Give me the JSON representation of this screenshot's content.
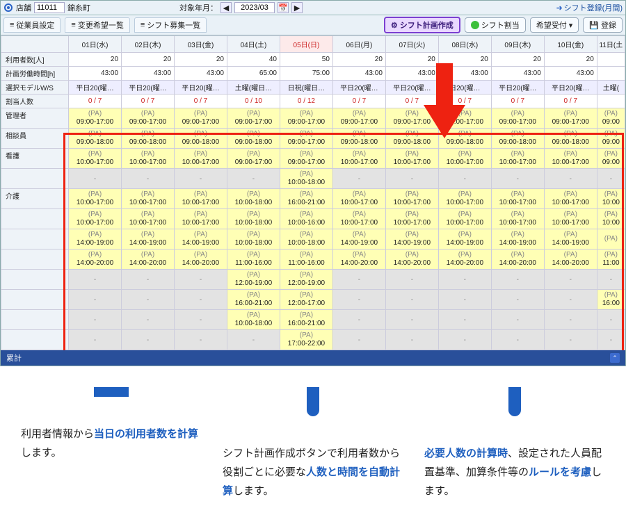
{
  "topbar": {
    "store_label": "店舗",
    "store_code": "11011",
    "store_name": "錦糸町",
    "period_label": "対象年月：",
    "period_value": "2023/03",
    "register_month": "シフト登録(月間)"
  },
  "tabs": {
    "emp_settings": "従業員設定",
    "change_req_list": "変更希望一覧",
    "recruit_list": "シフト募集一覧",
    "plan_create": "シフト計画作成",
    "shift_assign": "シフト割当",
    "pref_accept": "希望受付",
    "register": "登録"
  },
  "row_labels": {
    "users": "利用者数[人]",
    "plan_hours": "計画労働時間[h]",
    "model": "選択モデルW/S",
    "assigned": "割当人数",
    "manager": "管理者",
    "counselor": "相談員",
    "nurse": "看護",
    "care": "介護"
  },
  "pa_label": "(PA)",
  "dash": "-",
  "footer_label": "累計",
  "dates": [
    {
      "label": "01日(水)",
      "sunday": false
    },
    {
      "label": "02日(木)",
      "sunday": false
    },
    {
      "label": "03日(金)",
      "sunday": false
    },
    {
      "label": "04日(土)",
      "sunday": false
    },
    {
      "label": "05日(日)",
      "sunday": true
    },
    {
      "label": "06日(月)",
      "sunday": false
    },
    {
      "label": "07日(火)",
      "sunday": false
    },
    {
      "label": "08日(水)",
      "sunday": false
    },
    {
      "label": "09日(木)",
      "sunday": false
    },
    {
      "label": "10日(金)",
      "sunday": false
    },
    {
      "label": "11日(土",
      "sunday": false
    }
  ],
  "users_row": [
    "20",
    "20",
    "20",
    "40",
    "50",
    "20",
    "20",
    "20",
    "20",
    "20",
    ""
  ],
  "hours_row": [
    "43:00",
    "43:00",
    "43:00",
    "65:00",
    "75:00",
    "43:00",
    "43:00",
    "43:00",
    "43:00",
    "43:00",
    ""
  ],
  "model_row": [
    "平日20(曜…",
    "平日20(曜…",
    "平日20(曜…",
    "土曜(曜日…",
    "日祝(曜日…",
    "平日20(曜…",
    "平日20(曜…",
    "日20(曜…",
    "平日20(曜…",
    "平日20(曜…",
    "土曜("
  ],
  "assigned_row": [
    "0 / 7",
    "0 / 7",
    "0 / 7",
    "0 / 10",
    "0 / 12",
    "0 / 7",
    "0 / 7",
    "0 / 7",
    "0 / 7",
    "0 / 7",
    ""
  ],
  "shift_rows": [
    {
      "role": "manager",
      "cells": [
        {
          "t": "09:00-17:00"
        },
        {
          "t": "09:00-17:00"
        },
        {
          "t": "09:00-17:00"
        },
        {
          "t": "09:00-17:00"
        },
        {
          "t": "09:00-17:00"
        },
        {
          "t": "09:00-17:00"
        },
        {
          "t": "09:00-17:00"
        },
        {
          "t": "09:00-17:00"
        },
        {
          "t": "09:00-17:00"
        },
        {
          "t": "09:00-17:00"
        },
        {
          "t": "09:00",
          "cut": true
        }
      ]
    },
    {
      "role": "counselor",
      "cells": [
        {
          "t": "09:00-18:00"
        },
        {
          "t": "09:00-18:00"
        },
        {
          "t": "09:00-18:00"
        },
        {
          "t": "09:00-18:00"
        },
        {
          "t": "09:00-17:00"
        },
        {
          "t": "09:00-18:00"
        },
        {
          "t": "09:00-18:00"
        },
        {
          "t": "09:00-18:00"
        },
        {
          "t": "09:00-18:00"
        },
        {
          "t": "09:00-18:00"
        },
        {
          "t": "09:00",
          "cut": true
        }
      ]
    },
    {
      "role": "nurse",
      "cells": [
        {
          "t": "10:00-17:00"
        },
        {
          "t": "10:00-17:00"
        },
        {
          "t": "10:00-17:00"
        },
        {
          "t": "09:00-17:00"
        },
        {
          "t": "09:00-17:00"
        },
        {
          "t": "10:00-17:00"
        },
        {
          "t": "10:00-17:00"
        },
        {
          "t": "10:00-17:00"
        },
        {
          "t": "10:00-17:00"
        },
        {
          "t": "10:00-17:00"
        },
        {
          "t": "09:00",
          "cut": true
        }
      ]
    },
    {
      "role": "",
      "cells": [
        {
          "blank": true
        },
        {
          "blank": true
        },
        {
          "blank": true
        },
        {
          "blank": true
        },
        {
          "t": "10:00-18:00"
        },
        {
          "blank": true
        },
        {
          "blank": true
        },
        {
          "blank": true
        },
        {
          "blank": true
        },
        {
          "blank": true
        },
        {
          "blank": true
        }
      ]
    },
    {
      "role": "care",
      "cells": [
        {
          "t": "10:00-17:00"
        },
        {
          "t": "10:00-17:00"
        },
        {
          "t": "10:00-17:00"
        },
        {
          "t": "10:00-18:00"
        },
        {
          "t": "16:00-21:00"
        },
        {
          "t": "10:00-17:00"
        },
        {
          "t": "10:00-17:00"
        },
        {
          "t": "10:00-17:00"
        },
        {
          "t": "10:00-17:00"
        },
        {
          "t": "10:00-17:00"
        },
        {
          "t": "10:00",
          "cut": true
        }
      ]
    },
    {
      "role": "",
      "cells": [
        {
          "t": "10:00-17:00"
        },
        {
          "t": "10:00-17:00"
        },
        {
          "t": "10:00-17:00"
        },
        {
          "t": "10:00-18:00"
        },
        {
          "t": "10:00-16:00"
        },
        {
          "t": "10:00-17:00"
        },
        {
          "t": "10:00-17:00"
        },
        {
          "t": "10:00-17:00"
        },
        {
          "t": "10:00-17:00"
        },
        {
          "t": "10:00-17:00"
        },
        {
          "t": "10:00",
          "cut": true
        }
      ]
    },
    {
      "role": "",
      "cells": [
        {
          "t": "14:00-19:00"
        },
        {
          "t": "14:00-19:00"
        },
        {
          "t": "14:00-19:00"
        },
        {
          "t": "10:00-18:00"
        },
        {
          "t": "10:00-18:00"
        },
        {
          "t": "14:00-19:00"
        },
        {
          "t": "14:00-19:00"
        },
        {
          "t": "14:00-19:00"
        },
        {
          "t": "14:00-19:00"
        },
        {
          "t": "14:00-19:00"
        },
        {
          "t": "",
          "cut": true
        }
      ]
    },
    {
      "role": "",
      "cells": [
        {
          "t": "14:00-20:00"
        },
        {
          "t": "14:00-20:00"
        },
        {
          "t": "14:00-20:00"
        },
        {
          "t": "11:00-16:00"
        },
        {
          "t": "11:00-16:00"
        },
        {
          "t": "14:00-20:00"
        },
        {
          "t": "14:00-20:00"
        },
        {
          "t": "14:00-20:00"
        },
        {
          "t": "14:00-20:00"
        },
        {
          "t": "14:00-20:00"
        },
        {
          "t": "11:00",
          "cut": true
        }
      ]
    },
    {
      "role": "",
      "cells": [
        {
          "blank": true
        },
        {
          "blank": true
        },
        {
          "blank": true
        },
        {
          "t": "12:00-19:00"
        },
        {
          "t": "12:00-19:00"
        },
        {
          "blank": true
        },
        {
          "blank": true
        },
        {
          "blank": true
        },
        {
          "blank": true
        },
        {
          "blank": true
        },
        {
          "blank": true
        }
      ]
    },
    {
      "role": "",
      "cells": [
        {
          "blank": true
        },
        {
          "blank": true
        },
        {
          "blank": true
        },
        {
          "t": "16:00-21:00"
        },
        {
          "t": "12:00-17:00"
        },
        {
          "blank": true
        },
        {
          "blank": true
        },
        {
          "blank": true
        },
        {
          "blank": true
        },
        {
          "blank": true
        },
        {
          "t": "16:00",
          "cut": true
        }
      ]
    },
    {
      "role": "",
      "cells": [
        {
          "blank": true
        },
        {
          "blank": true
        },
        {
          "blank": true
        },
        {
          "t": "10:00-18:00"
        },
        {
          "t": "16:00-21:00"
        },
        {
          "blank": true
        },
        {
          "blank": true
        },
        {
          "blank": true
        },
        {
          "blank": true
        },
        {
          "blank": true
        },
        {
          "blank": true
        }
      ]
    },
    {
      "role": "",
      "cells": [
        {
          "blank": true
        },
        {
          "blank": true
        },
        {
          "blank": true
        },
        {
          "blank": true
        },
        {
          "t": "17:00-22:00"
        },
        {
          "blank": true
        },
        {
          "blank": true
        },
        {
          "blank": true
        },
        {
          "blank": true
        },
        {
          "blank": true
        },
        {
          "blank": true
        }
      ]
    }
  ],
  "callouts": [
    {
      "pre": "利用者情報から",
      "em": "当日の利用者数を計算",
      "post": "します。"
    },
    {
      "pre": "シフト計画作成ボタンで利用者数から役割ごとに必要な",
      "em": "人数と時間を自動計算",
      "post": "します。"
    },
    {
      "pre": "",
      "em": "必要人数の計算時",
      "post": "、設定された人員配置基準、加算条件等の",
      "em2": "ルールを考慮",
      "post2": "します。"
    }
  ]
}
